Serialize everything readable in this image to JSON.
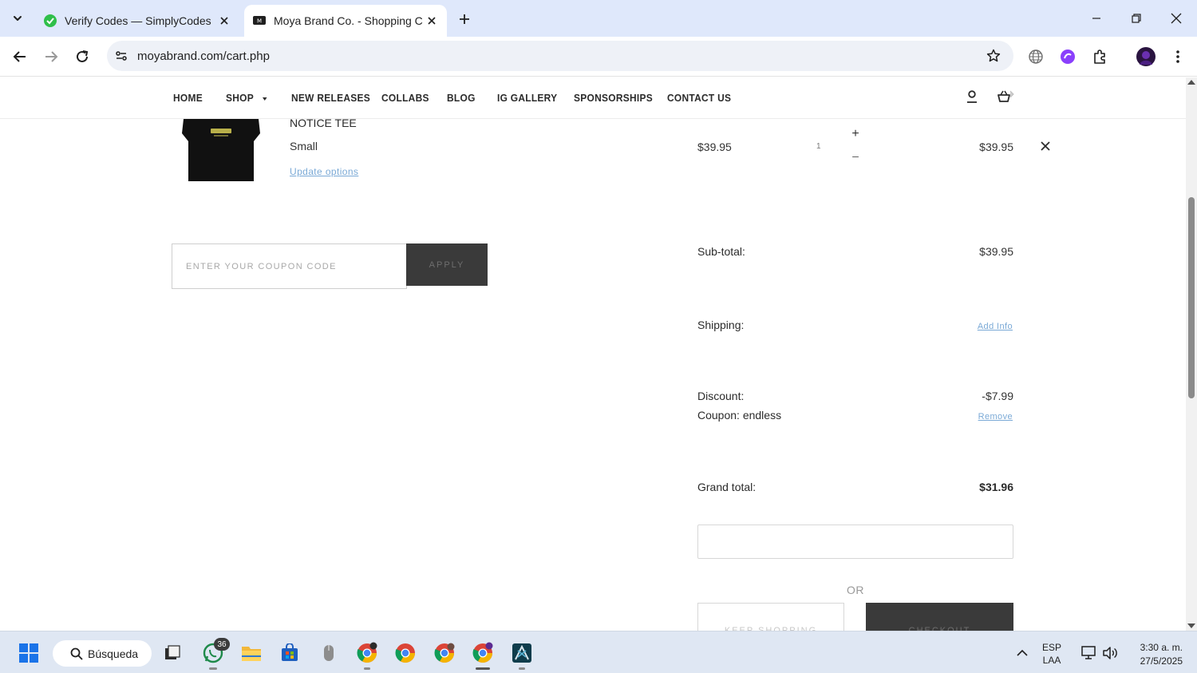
{
  "browser": {
    "tabs": [
      {
        "title": "Verify Codes — SimplyCodes",
        "active": false
      },
      {
        "title": "Moya Brand Co. - Shopping Cart",
        "active": true
      }
    ],
    "url": "moyabrand.com/cart.php"
  },
  "site_nav": {
    "items": [
      "HOME",
      "SHOP",
      "NEW RELEASES",
      "COLLABS",
      "BLOG",
      "IG GALLERY",
      "SPONSORSHIPS",
      "CONTACT US"
    ]
  },
  "cart_item": {
    "name": "NOTICE TEE",
    "size": "Small",
    "update_link": "Update options",
    "unit_price": "$39.95",
    "quantity": "1",
    "plus": "+",
    "minus": "–",
    "total": "$39.95"
  },
  "coupon": {
    "placeholder": "ENTER YOUR COUPON CODE",
    "apply_label": "APPLY"
  },
  "summary": {
    "subtotal_label": "Sub-total:",
    "subtotal_value": "$39.95",
    "shipping_label": "Shipping:",
    "shipping_link": "Add Info",
    "discount_label": "Discount:",
    "discount_value": "-$7.99",
    "coupon_label": "Coupon: endless",
    "coupon_remove": "Remove",
    "grand_label": "Grand total:",
    "grand_value": "$31.96",
    "or_text": "OR",
    "keep_shopping": "KEEP SHOPPING",
    "checkout": "CHECKOUT"
  },
  "taskbar": {
    "search_label": "Búsqueda",
    "whatsapp_badge": "36",
    "language_top": "ESP",
    "language_bottom": "LAA",
    "time": "3:30 a. m.",
    "date": "27/5/2025"
  },
  "colors": {
    "tabbar_bg": "#dfe8fb",
    "dark_button": "#3a3a3a",
    "link_blue": "#7aa9d6",
    "taskbar_bg": "#dfe7f3"
  }
}
